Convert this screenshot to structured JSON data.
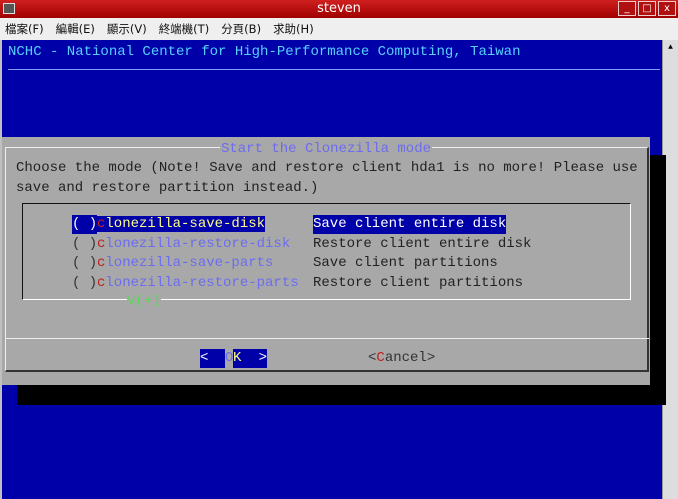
{
  "window": {
    "title": "steven"
  },
  "menu": [
    "檔案(F)",
    "編輯(E)",
    "顯示(V)",
    "終端機(T)",
    "分頁(B)",
    "求助(H)"
  ],
  "header": "NCHC - National Center for High-Performance Computing, Taiwan",
  "dialog": {
    "title": "Start the Clonezilla mode",
    "prompt": "Choose the mode (Note! Save and restore client hda1 is no more! Please use\nsave and restore partition instead.)",
    "items": [
      {
        "radio": "( )",
        "hotkey": "c",
        "tag": "lonezilla-save-disk",
        "desc": "Save client entire disk"
      },
      {
        "radio": "( )",
        "hotkey": "c",
        "tag": "lonezilla-restore-disk",
        "desc": "Restore client entire disk"
      },
      {
        "radio": "( )",
        "hotkey": "c",
        "tag": "lonezilla-save-parts",
        "desc": "Save client partitions"
      },
      {
        "radio": "( )",
        "hotkey": "c",
        "tag": "lonezilla-restore-parts",
        "desc": "Restore client partitions"
      }
    ],
    "more": "v(+)",
    "ok": {
      "left": "<",
      "hotkey": "O",
      "rest": "K",
      "right": ">"
    },
    "cancel": {
      "left": "<",
      "hotkey": "C",
      "rest": "ancel",
      "right": ">"
    }
  }
}
